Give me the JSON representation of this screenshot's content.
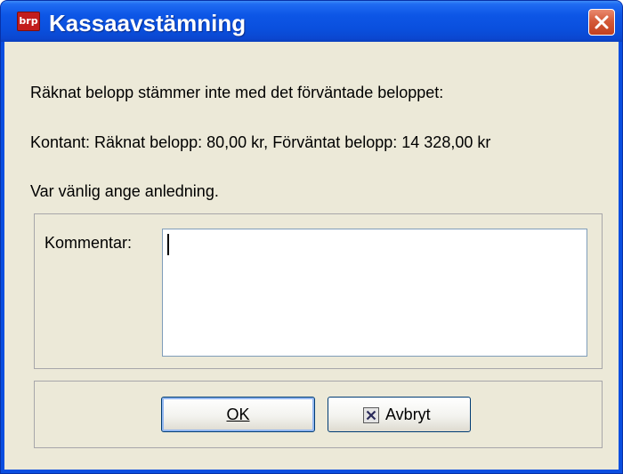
{
  "window": {
    "title": "Kassaavstämning",
    "app_icon_text": "brp",
    "app_icon_color": "#c21d1d"
  },
  "message": {
    "line1": "Räknat belopp stämmer inte med det förväntade beloppet:",
    "line2": "Kontant: Räknat belopp: 80,00 kr, Förväntat belopp: 14 328,00 kr",
    "line3": "Var vänlig ange anledning."
  },
  "comment": {
    "label": "Kommentar:",
    "value": ""
  },
  "buttons": {
    "ok_label": "OK",
    "cancel_label": "Avbryt"
  },
  "icons": {
    "close": "close-icon",
    "cancel": "x-box-icon"
  },
  "colors": {
    "titlebar_blue": "#0a4fdd",
    "dialog_background": "#ece9d8",
    "close_button_red": "#d45a39"
  }
}
